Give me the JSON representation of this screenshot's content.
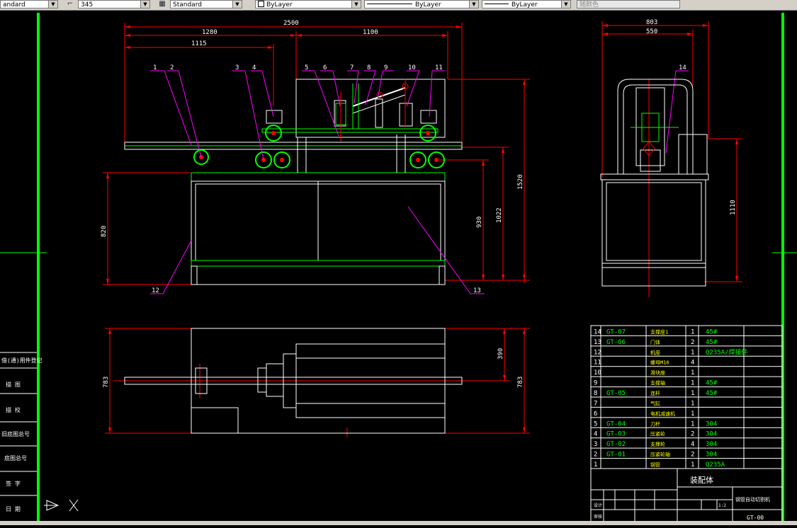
{
  "toolbar": {
    "text_style": "andard",
    "dim_value": "345",
    "table_style": "Standard",
    "layer": "ByLayer",
    "linetype": "ByLayer",
    "lineweight": "ByLayer",
    "plot_style": "随颜色"
  },
  "dimensions": {
    "overall_length": "2500",
    "left_span": "1280",
    "left_inner": "1115",
    "right_span": "1100",
    "table_height": "820",
    "height_930": "930",
    "height_1022": "1022",
    "total_height": "1520",
    "side_width": "803",
    "side_inner": "550",
    "side_height": "1110",
    "plan_width_left": "783",
    "plan_width_right": "783",
    "plan_offset": "390"
  },
  "balloons": [
    "1",
    "2",
    "3",
    "4",
    "5",
    "6",
    "7",
    "8",
    "9",
    "10",
    "11",
    "12",
    "13",
    "14"
  ],
  "bom": {
    "rows": [
      {
        "no": "14",
        "code": "GT-07",
        "name": "支撑座1",
        "qty": "1",
        "mat": "45#"
      },
      {
        "no": "13",
        "code": "GT-06",
        "name": "门体",
        "qty": "2",
        "mat": "45#"
      },
      {
        "no": "12",
        "code": "",
        "name": "机座",
        "qty": "1",
        "mat": "Q235A/焊接件"
      },
      {
        "no": "11",
        "code": "",
        "name": "螺母M16",
        "qty": "4",
        "mat": ""
      },
      {
        "no": "10",
        "code": "",
        "name": "滑块座",
        "qty": "1",
        "mat": ""
      },
      {
        "no": "9",
        "code": "",
        "name": "支撑轴",
        "qty": "1",
        "mat": "45#"
      },
      {
        "no": "8",
        "code": "GT-05",
        "name": "连杆",
        "qty": "1",
        "mat": "45#"
      },
      {
        "no": "7",
        "code": "",
        "name": "气缸",
        "qty": "1",
        "mat": ""
      },
      {
        "no": "6",
        "code": "",
        "name": "电机减速机",
        "qty": "1",
        "mat": ""
      },
      {
        "no": "5",
        "code": "GT-04",
        "name": "刀杆",
        "qty": "1",
        "mat": "304"
      },
      {
        "no": "4",
        "code": "GT-03",
        "name": "压紧轮",
        "qty": "2",
        "mat": "304"
      },
      {
        "no": "3",
        "code": "GT-02",
        "name": "支撑轮",
        "qty": "4",
        "mat": "304"
      },
      {
        "no": "2",
        "code": "GT-01",
        "name": "压紧轮轴",
        "qty": "2",
        "mat": "304"
      },
      {
        "no": "1",
        "code": "",
        "name": "钢管",
        "qty": "1",
        "mat": "Q235A"
      }
    ]
  },
  "title_block": {
    "drawing_name": "装配体",
    "machine_name": "钢管自动切割机",
    "drawing_no": "GT-00",
    "label_design": "设计",
    "label_check": "审核",
    "label_scale": "1:2"
  },
  "left_panel": {
    "items": [
      "借(通)用件登记",
      "描 图",
      "描 校",
      "旧底图总号",
      "底图总号",
      "签 字",
      "日 期"
    ]
  },
  "colors": {
    "green": "#00ff00",
    "yellow": "#ffff00",
    "magenta": "#ff00ff",
    "red": "#ff0000",
    "white": "#ffffff",
    "cyan": "#00ffff"
  }
}
